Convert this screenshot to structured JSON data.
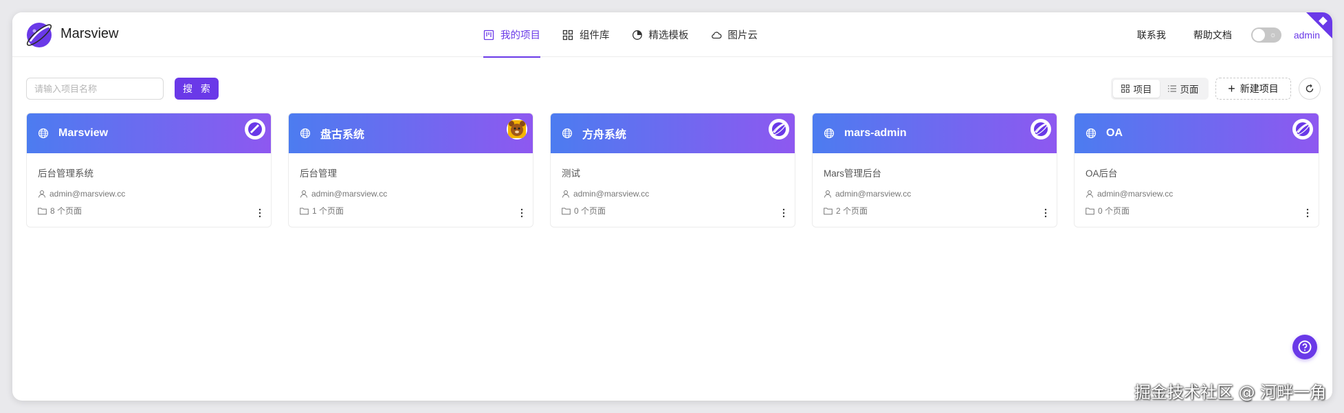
{
  "app": {
    "brand": "Marsview"
  },
  "nav": [
    {
      "label": "我的项目",
      "icon": "project-board-icon",
      "active": true
    },
    {
      "label": "组件库",
      "icon": "grid-icon",
      "active": false
    },
    {
      "label": "精选模板",
      "icon": "pie-chart-icon",
      "active": false
    },
    {
      "label": "图片云",
      "icon": "cloud-icon",
      "active": false
    }
  ],
  "header": {
    "contact": "联系我",
    "docs": "帮助文档",
    "theme_toggle_icon": "sun-icon",
    "user": "admin"
  },
  "toolbar": {
    "search_placeholder": "请输入项目名称",
    "search_value": "",
    "search_button": "搜 索",
    "view_project": "项目",
    "view_page": "页面",
    "active_view": "项目",
    "new_project": "新建项目",
    "refresh_icon": "refresh-icon"
  },
  "colors": {
    "accent": "#6a39e8",
    "card_gradient_start": "#4c7cf0",
    "card_gradient_end": "#8e58f0"
  },
  "projects": [
    {
      "name": "Marsview",
      "desc": "后台管理系统",
      "owner": "admin@marsview.cc",
      "pages": "8 个页面",
      "avatar": "logo-icon"
    },
    {
      "name": "盘古系统",
      "desc": "后台管理",
      "owner": "admin@marsview.cc",
      "pages": "1 个页面",
      "avatar": "bear-face-icon"
    },
    {
      "name": "方舟系统",
      "desc": "测试",
      "owner": "admin@marsview.cc",
      "pages": "0 个页面",
      "avatar": "planet-icon"
    },
    {
      "name": "mars-admin",
      "desc": "Mars管理后台",
      "owner": "admin@marsview.cc",
      "pages": "2 个页面",
      "avatar": "planet-icon"
    },
    {
      "name": "OA",
      "desc": "OA后台",
      "owner": "admin@marsview.cc",
      "pages": "0 个页面",
      "avatar": "planet-icon"
    }
  ],
  "watermark": "掘金技术社区 @ 河畔一角"
}
